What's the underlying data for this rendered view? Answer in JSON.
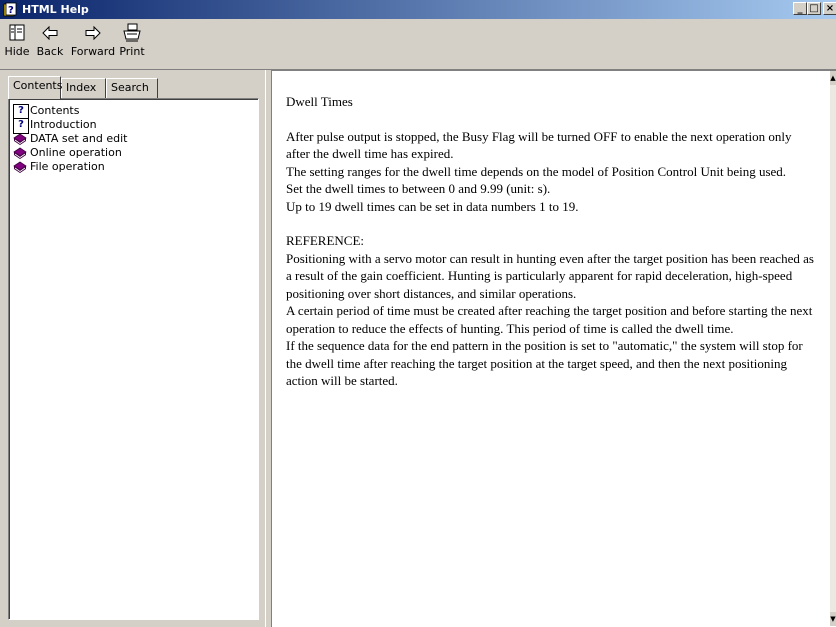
{
  "window": {
    "title": "HTML Help",
    "minimize": "_",
    "maximize": "□",
    "close": "×"
  },
  "toolbar": {
    "hide_label": "Hide",
    "back_label": "Back",
    "forward_label": "Forward",
    "print_label": "Print"
  },
  "tabs": {
    "contents": "Contents",
    "index": "Index",
    "search": "Search"
  },
  "tree": {
    "items": [
      {
        "label": "Contents",
        "icon": "help-page-icon"
      },
      {
        "label": "Introduction",
        "icon": "help-page-icon"
      },
      {
        "label": "DATA set and edit",
        "icon": "book-icon"
      },
      {
        "label": "Online operation",
        "icon": "book-icon"
      },
      {
        "label": "File operation",
        "icon": "book-icon"
      }
    ]
  },
  "content": {
    "heading": "Dwell Times",
    "p1": "After pulse output is stopped, the Busy Flag will be turned OFF to enable the next operation only after the dwell time has expired.",
    "p2": "The setting ranges for the dwell time depends on the model of Position Control Unit being used.",
    "p3": "Set the dwell times to between 0 and 9.99 (unit: s).",
    "p4": "Up to 19 dwell times can be set in data numbers 1 to 19.",
    "reference_heading": "REFERENCE:",
    "r1": "Positioning with a servo motor can result in hunting even after the target position has been reached as a result of the gain coefficient. Hunting is particularly apparent for rapid deceleration, high-speed positioning over short distances, and similar operations.",
    "r2": "A certain period of time must be created after reaching the target position and before starting the next operation to reduce the effects of hunting. This period of time is called the dwell time.",
    "r3": "If the sequence data for the end pattern in the position is set to \"automatic,\" the system will stop for the dwell time after reaching the target position at the target speed, and then the next positioning action will be started."
  },
  "colors": {
    "titlebar_start": "#0a246a",
    "titlebar_end": "#a6caf0",
    "face": "#d4d0c8",
    "book": "#800080"
  }
}
